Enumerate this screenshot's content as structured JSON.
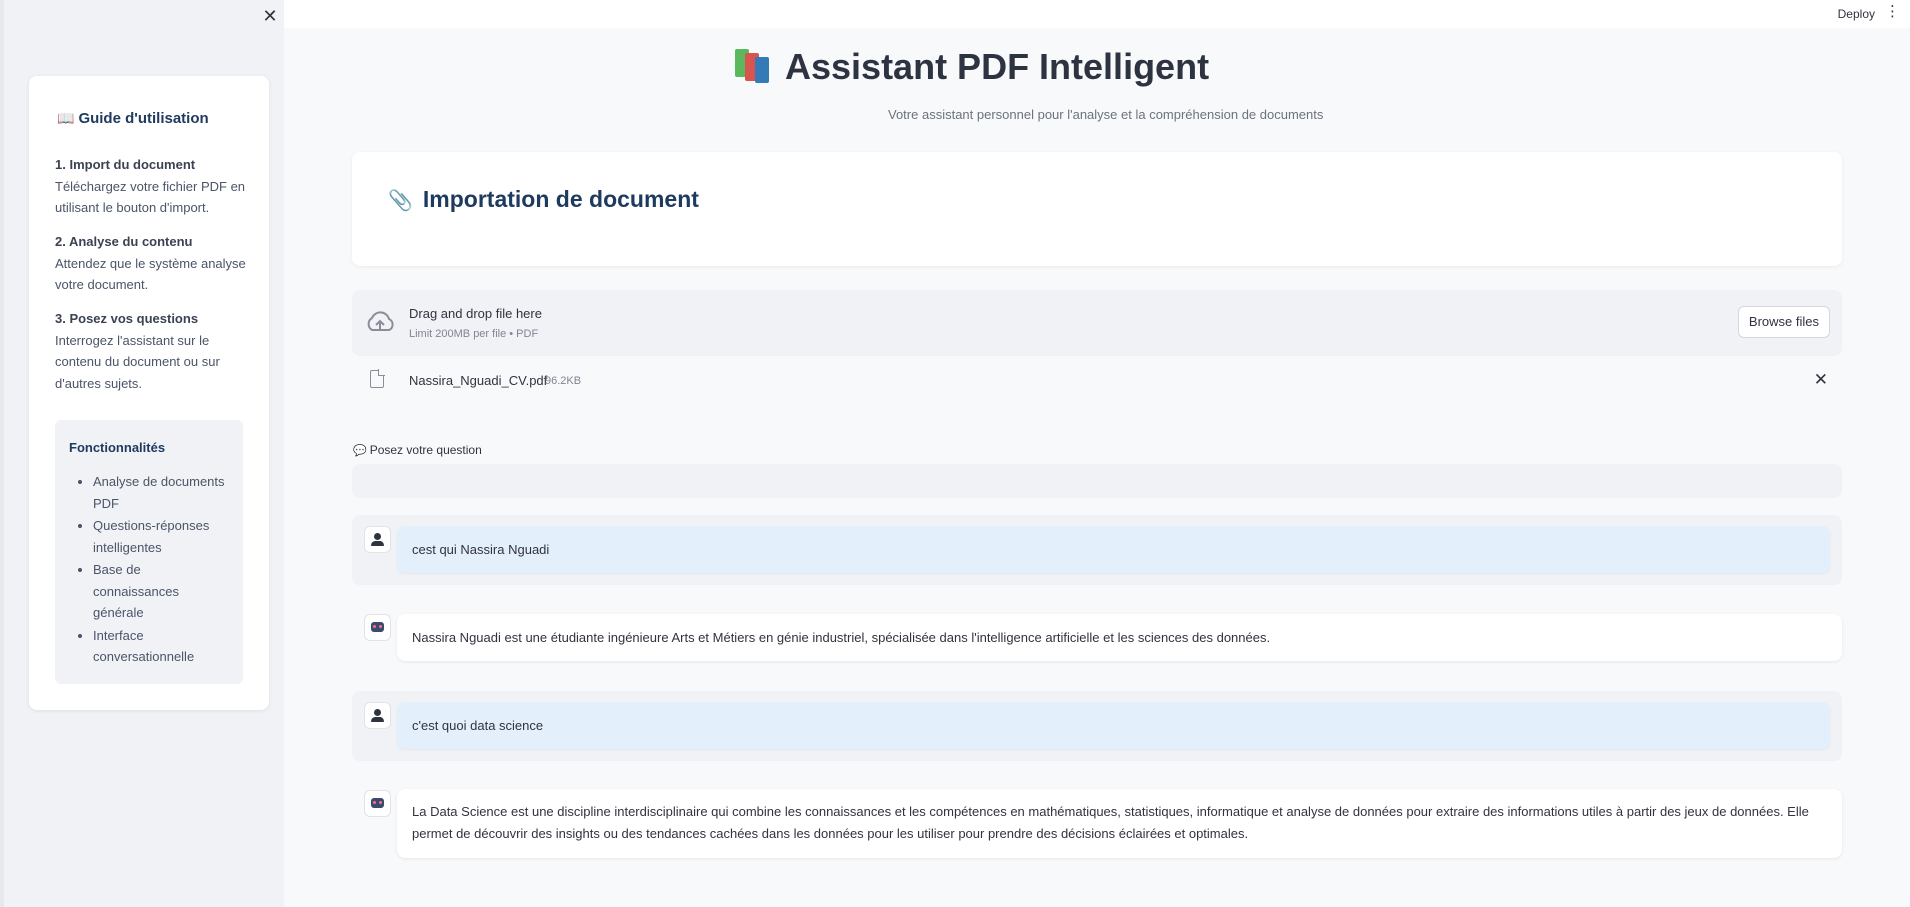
{
  "header": {
    "deploy_label": "Deploy",
    "menu_icon": "kebab-menu-icon"
  },
  "sidebar": {
    "close_icon": "close-icon",
    "guide": {
      "title": "Guide d'utilisation",
      "title_icon": "book-icon",
      "steps": [
        {
          "head": "1. Import du document",
          "text": "Téléchargez votre fichier PDF en utilisant le bouton d'import."
        },
        {
          "head": "2. Analyse du contenu",
          "text": "Attendez que le système analyse votre document."
        },
        {
          "head": "3. Posez vos questions",
          "text": "Interrogez l'assistant sur le contenu du document ou sur d'autres sujets."
        }
      ]
    },
    "features": {
      "title": "Fonctionnalités",
      "items": [
        "Analyse de documents PDF",
        "Questions-réponses intelligentes",
        "Base de connaissances générale",
        "Interface conversationnelle"
      ]
    }
  },
  "main": {
    "title": "Assistant PDF Intelligent",
    "title_icon": "books-icon",
    "subtitle": "Votre assistant personnel pour l'analyse et la compréhension de documents",
    "import_section": {
      "title": "Importation de document",
      "icon": "paperclip-icon"
    },
    "uploader": {
      "drop_label": "Drag and drop file here",
      "limit_label": "Limit 200MB per file • PDF",
      "browse_label": "Browse files",
      "file": {
        "name": "Nassira_Nguadi_CV.pdf",
        "size": "96.2KB"
      }
    },
    "question": {
      "label": "Posez votre question",
      "value": ""
    },
    "chat": [
      {
        "role": "user",
        "text": "cest qui Nassira Nguadi"
      },
      {
        "role": "assistant",
        "text": "Nassira Nguadi est une étudiante ingénieure Arts et Métiers en génie industriel, spécialisée dans l'intelligence artificielle et les sciences des données."
      },
      {
        "role": "user",
        "text": "c'est quoi data science"
      },
      {
        "role": "assistant",
        "text": "La Data Science est une discipline interdisciplinaire qui combine les connaissances et les compétences en mathématiques, statistiques, informatique et analyse de données pour extraire des informations utiles à partir des jeux de données. Elle permet de découvrir des insights ou des tendances cachées dans les données pour les utiliser pour prendre des décisions éclairées et optimales."
      }
    ]
  },
  "colors": {
    "accent_title": "#1e3a5f",
    "user_bubble": "#e3f0fb",
    "sidebar_bg": "#f0f2f6"
  }
}
